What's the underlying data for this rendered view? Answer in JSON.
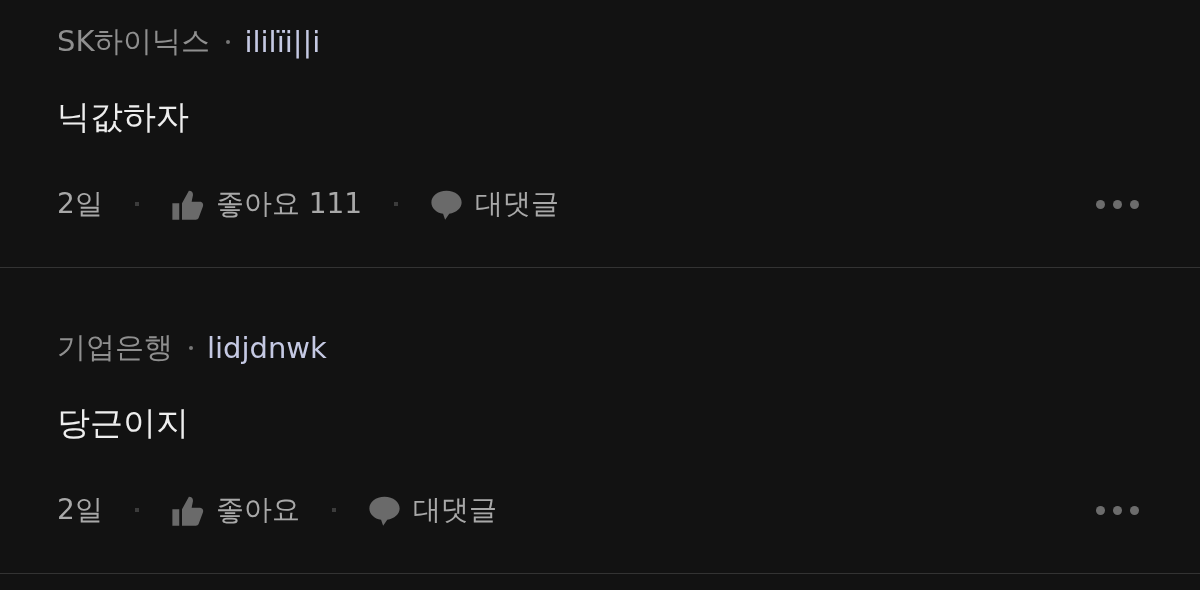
{
  "comments": [
    {
      "company": "SK하이닉스",
      "username": "ililïi||i",
      "text": "닉값하자",
      "time": "2일",
      "like_label": "좋아요",
      "like_count": "111",
      "reply_label": "대댓글"
    },
    {
      "company": "기업은행",
      "username": "lidjdnwk",
      "text": "당근이지",
      "time": "2일",
      "like_label": "좋아요",
      "reply_label": "대댓글"
    }
  ]
}
